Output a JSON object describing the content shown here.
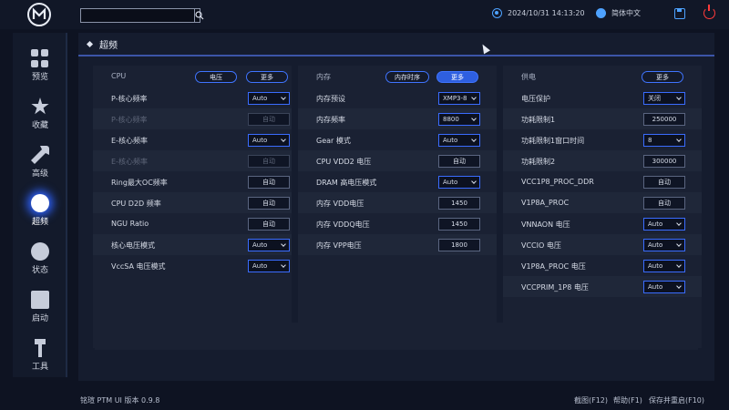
{
  "topbar": {
    "search_placeholder": "",
    "datetime": "2024/10/31 14:13:20",
    "language": "简体中文"
  },
  "sidebar": {
    "items": [
      {
        "label": "预览",
        "icon": "grid-icon"
      },
      {
        "label": "收藏",
        "icon": "star-icon"
      },
      {
        "label": "高级",
        "icon": "tools-icon"
      },
      {
        "label": "超频",
        "icon": "rocket-icon",
        "active": true
      },
      {
        "label": "状态",
        "icon": "gauge-icon"
      },
      {
        "label": "启动",
        "icon": "boot-icon"
      },
      {
        "label": "工具",
        "icon": "wrench-icon"
      }
    ]
  },
  "main": {
    "section_title": "超频",
    "columns": [
      {
        "title": "CPU",
        "pills": [
          "电压",
          "更多"
        ],
        "rows": [
          {
            "label": "P-核心频率",
            "type": "select",
            "value": "Auto"
          },
          {
            "label": "P-核心频率",
            "type": "button",
            "value": "自动",
            "disabled": true
          },
          {
            "label": "E-核心频率",
            "type": "select",
            "value": "Auto"
          },
          {
            "label": "E-核心频率",
            "type": "button",
            "value": "自动",
            "disabled": true
          },
          {
            "label": "Ring最大OC频率",
            "type": "button",
            "value": "自动"
          },
          {
            "label": "CPU D2D 频率",
            "type": "button",
            "value": "自动"
          },
          {
            "label": "NGU Ratio",
            "type": "button",
            "value": "自动"
          },
          {
            "label": "核心电压模式",
            "type": "select",
            "value": "Auto"
          },
          {
            "label": "VccSA 电压模式",
            "type": "select",
            "value": "Auto"
          }
        ]
      },
      {
        "title": "内存",
        "pills": [
          "内存时序",
          "更多"
        ],
        "rows": [
          {
            "label": "内存预设",
            "type": "select",
            "value": "XMP3-8"
          },
          {
            "label": "内存频率",
            "type": "select",
            "value": "8800"
          },
          {
            "label": "Gear 模式",
            "type": "select",
            "value": "Auto"
          },
          {
            "label": "CPU VDD2 电压",
            "type": "button",
            "value": "自动"
          },
          {
            "label": "DRAM 高电压模式",
            "type": "select",
            "value": "Auto"
          },
          {
            "label": "内存 VDD电压",
            "type": "value",
            "value": "1450"
          },
          {
            "label": "内存 VDDQ电压",
            "type": "value",
            "value": "1450"
          },
          {
            "label": "内存 VPP电压",
            "type": "value",
            "value": "1800"
          }
        ]
      },
      {
        "title": "供电",
        "pills": [
          "更多"
        ],
        "rows": [
          {
            "label": "电压保护",
            "type": "select",
            "value": "关闭"
          },
          {
            "label": "功耗限制1",
            "type": "value",
            "value": "250000"
          },
          {
            "label": "功耗限制1窗口时间",
            "type": "select",
            "value": "8"
          },
          {
            "label": "功耗限制2",
            "type": "value",
            "value": "300000"
          },
          {
            "label": "VCC1P8_PROC_DDR",
            "type": "button",
            "value": "自动"
          },
          {
            "label": "V1P8A_PROC",
            "type": "button",
            "value": "自动"
          },
          {
            "label": "VNNAON 电压",
            "type": "select",
            "value": "Auto"
          },
          {
            "label": "VCCIO 电压",
            "type": "select",
            "value": "Auto"
          },
          {
            "label": "V1P8A_PROC 电压",
            "type": "select",
            "value": "Auto"
          },
          {
            "label": "VCCPRIM_1P8 电压",
            "type": "select",
            "value": "Auto"
          }
        ]
      }
    ]
  },
  "footer": {
    "version": "铭瑄 PTM UI 版本 0.9.8",
    "screenshot": "截图(F12)",
    "help": "帮助(F1)",
    "save_reboot": "保存并重启(F10)"
  },
  "colors": {
    "accent": "#3a6cff",
    "power": "#ff3b3b",
    "background": "#0e1322"
  }
}
